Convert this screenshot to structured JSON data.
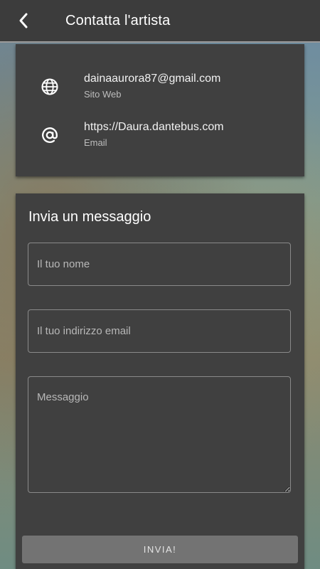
{
  "header": {
    "back_icon": "chevron-left-icon",
    "title": "Contatta l'artista"
  },
  "contacts": [
    {
      "icon": "globe-icon",
      "value": "dainaaurora87@gmail.com",
      "label": "Sito Web"
    },
    {
      "icon": "at-icon",
      "value": "https://Daura.dantebus.com",
      "label": "Email"
    }
  ],
  "form": {
    "title": "Invia un messaggio",
    "name_placeholder": "Il tuo nome",
    "email_placeholder": "Il tuo indirizzo email",
    "message_placeholder": "Messaggio",
    "submit_label": "INVIA!"
  },
  "colors": {
    "header_bg": "#3c3c3c",
    "card_bg": "#404040",
    "button_bg": "#737373"
  }
}
